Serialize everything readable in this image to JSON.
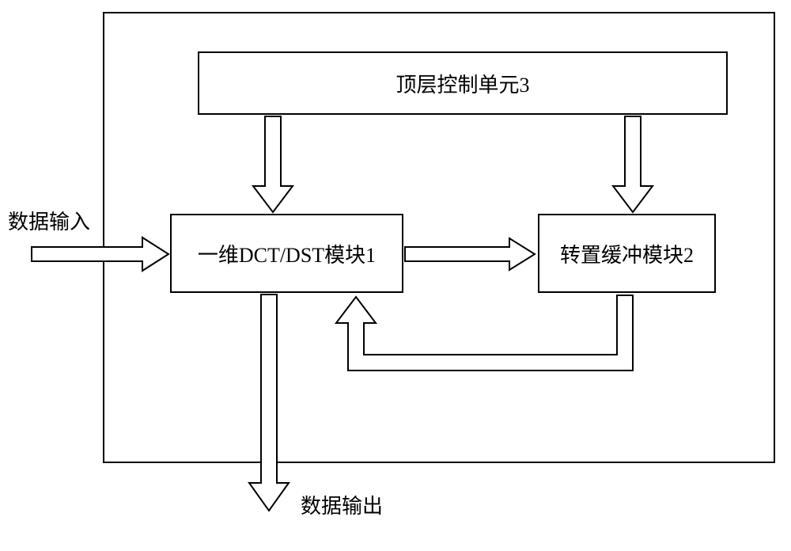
{
  "diagram": {
    "input_label": "数据输入",
    "output_label": "数据输出",
    "top_control": "顶层控制单元3",
    "dct_dst": "一维DCT/DST模块1",
    "transpose_buffer": "转置缓冲模块2"
  }
}
